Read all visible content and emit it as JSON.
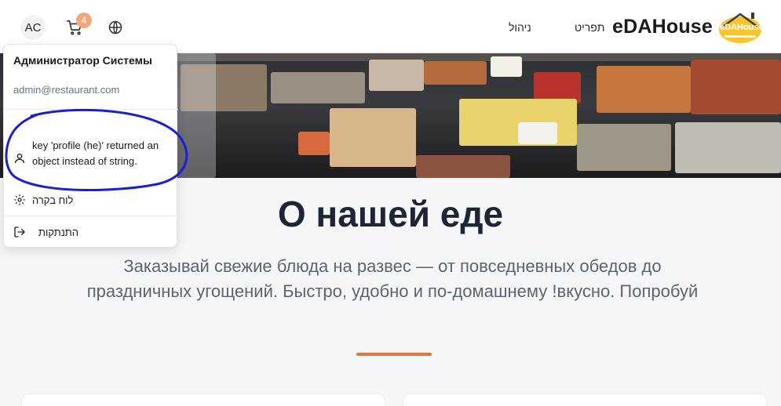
{
  "header": {
    "avatar_initials": "AC",
    "cart_count": "4",
    "nav": {
      "admin": "ניהול",
      "menu": "תפריט"
    },
    "brand": "eDAHouse",
    "logo_text": "eDAHouse",
    "accent_color": "#f4a77b"
  },
  "user_menu": {
    "name": "Администратор Системы",
    "email": "admin@restaurant.com",
    "profile_label": "key 'profile (he)' returned an object instead of string.",
    "dashboard_label": "לוח בקרה",
    "logout_label": "התנתקות",
    "icons": [
      "user-icon",
      "gear-icon",
      "logout-icon"
    ]
  },
  "about": {
    "title": "О нашей еде",
    "description": "Заказывай свежие блюда на развес — от повседневных обедов до праздничных угощений. Быстро, удобно и по-домашнему !вкусно. Попробуй",
    "divider_color": "#e8733b"
  }
}
